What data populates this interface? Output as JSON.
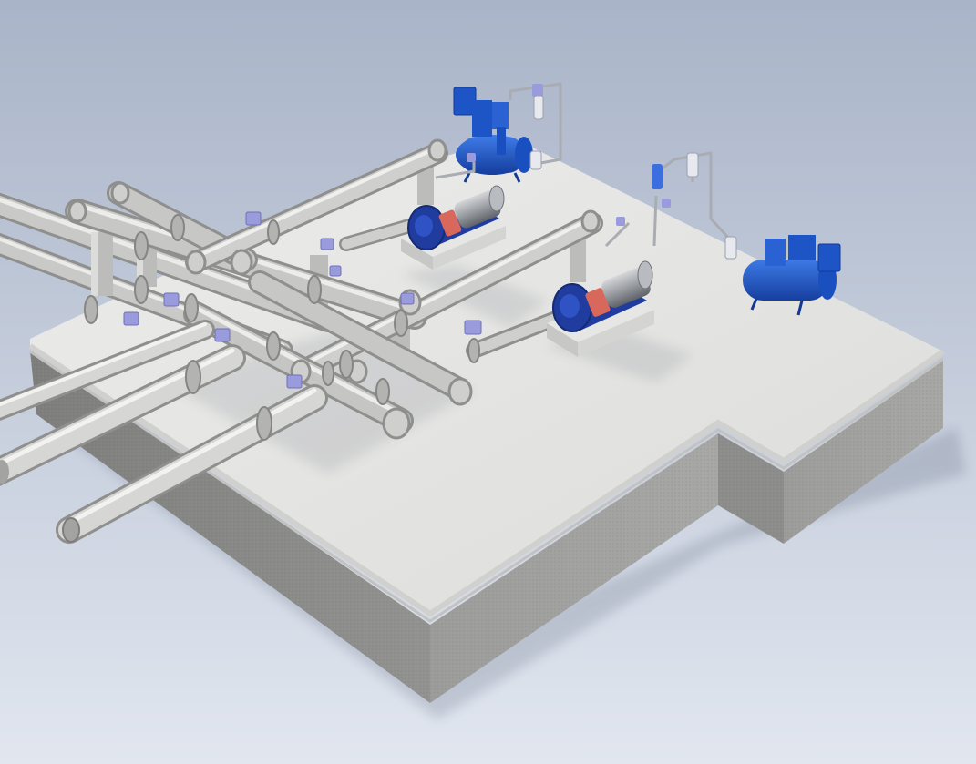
{
  "scene": {
    "subject": "3d-render-pump-station-piping",
    "colors": {
      "sky_top": "#a9b4c8",
      "sky_bottom": "#dfe5ef",
      "slab_top": "#e3e3e1",
      "slab_side_left": "#8a8a88",
      "slab_side_right": "#9c9c9a",
      "slab_edge": "#d2d2d0",
      "pipe_light": "#e4e4e2",
      "pipe_mid": "#b8b8b6",
      "pipe_dark": "#8f8f8d",
      "valve": "#9a9bdc",
      "pump_blue": "#1f3c9e",
      "pump_blue_dark": "#172b73",
      "tank_blue": "#1d55c7",
      "coupling_red": "#d9685c",
      "motor_steel": "#9b9ea3",
      "base_plinth": "#d6d6d4"
    },
    "components": [
      "concrete-slab",
      "pipe-manifold",
      "pump-unit-1",
      "pump-unit-2",
      "vacuum-tank-unit-1",
      "vacuum-tank-unit-2",
      "instrument-tubing"
    ]
  }
}
